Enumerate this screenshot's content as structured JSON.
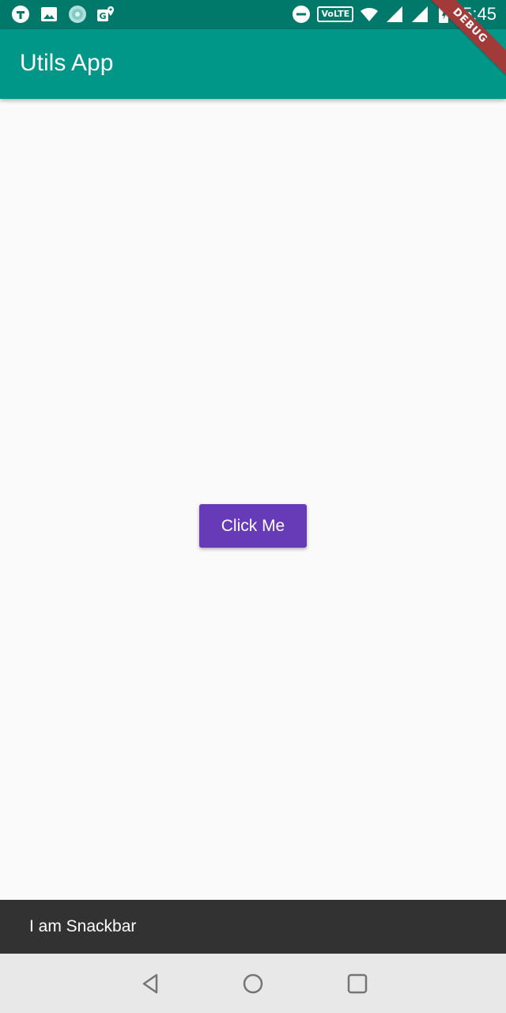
{
  "status_bar": {
    "left_icons": [
      "t-app-icon",
      "image-icon",
      "circle-app-icon",
      "map-pin-icon"
    ],
    "right_icons": [
      "do-not-disturb-icon",
      "volte-badge",
      "wifi-icon",
      "signal-icon",
      "signal-icon",
      "battery-icon"
    ],
    "volte_label": "VoLTE",
    "time": "5:45"
  },
  "app_bar": {
    "title": "Utils App"
  },
  "debug_banner": {
    "label": "DEBUG"
  },
  "main": {
    "button_label": "Click Me"
  },
  "snackbar": {
    "message": "I am Snackbar"
  },
  "nav_bar": {
    "buttons": [
      "back-icon",
      "home-icon",
      "recents-icon"
    ]
  },
  "colors": {
    "status_bar": "#00796b",
    "app_bar": "#009688",
    "button": "#673ab7",
    "snackbar": "#323232",
    "background": "#fafafa",
    "nav_bar": "#e8e8e8",
    "debug_banner": "#a33a3a"
  }
}
